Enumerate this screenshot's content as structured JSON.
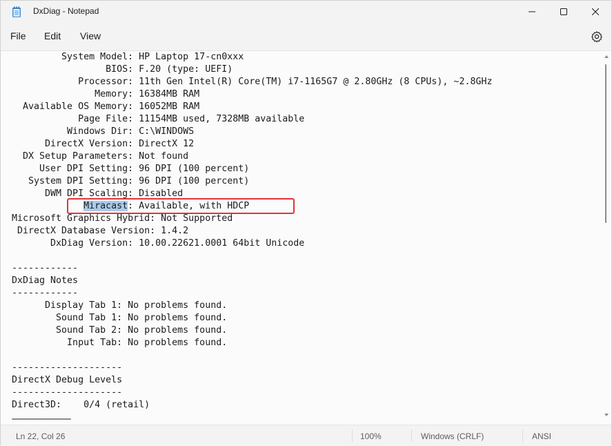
{
  "window": {
    "title": "DxDiag - Notepad"
  },
  "menu": {
    "file": "File",
    "edit": "Edit",
    "view": "View"
  },
  "editor": {
    "lines_before": [
      "         System Model: HP Laptop 17-cn0xxx",
      "                 BIOS: F.20 (type: UEFI)",
      "            Processor: 11th Gen Intel(R) Core(TM) i7-1165G7 @ 2.80GHz (8 CPUs), ~2.8GHz",
      "               Memory: 16384MB RAM",
      "  Available OS Memory: 16052MB RAM",
      "            Page File: 11154MB used, 7328MB available",
      "          Windows Dir: C:\\WINDOWS",
      "      DirectX Version: DirectX 12",
      "  DX Setup Parameters: Not found",
      "     User DPI Setting: 96 DPI (100 percent)",
      "   System DPI Setting: 96 DPI (100 percent)",
      "      DWM DPI Scaling: Disabled"
    ],
    "highlighted_line": {
      "prefix": "             ",
      "selected": "Miracast",
      "suffix": ": Available, with HDCP"
    },
    "lines_after": [
      "Microsoft Graphics Hybrid: Not Supported",
      " DirectX Database Version: 1.4.2",
      "       DxDiag Version: 10.00.22621.0001 64bit Unicode",
      "",
      "------------",
      "DxDiag Notes",
      "------------",
      "      Display Tab 1: No problems found.",
      "        Sound Tab 1: No problems found.",
      "        Sound Tab 2: No problems found.",
      "          Input Tab: No problems found.",
      "",
      "--------------------",
      "DirectX Debug Levels",
      "--------------------",
      "Direct3D:    0/4 (retail)"
    ]
  },
  "status": {
    "position": "Ln 22, Col 26",
    "zoom": "100%",
    "line_ending": "Windows (CRLF)",
    "encoding": "ANSI"
  },
  "colors": {
    "highlight_border": "#e0343a",
    "selection": "#a9cbe9"
  }
}
